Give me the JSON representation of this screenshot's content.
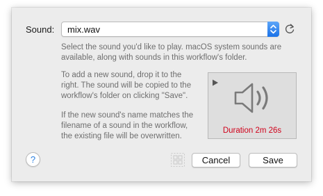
{
  "sound_field": {
    "label": "Sound:",
    "selected_value": "mix.wav"
  },
  "descriptions": {
    "select": "Select the sound you'd like to play. macOS system sounds are available, along with sounds in this workflow's folder.",
    "add": "To add a new sound, drop it to the right. The sound will be copied to the workflow's folder on clicking \"Save\".",
    "overwrite": "If the new sound's name matches the filename of a sound in the workflow, the existing file will be overwritten."
  },
  "preview": {
    "duration": "Duration 2m 26s",
    "duration_color": "#d0021b"
  },
  "buttons": {
    "help": "?",
    "cancel": "Cancel",
    "save": "Save"
  },
  "icons": {
    "refresh": "refresh-icon",
    "play": "play-icon",
    "speaker": "speaker-icon",
    "grid": "grid-icon",
    "chevron": "up-down-chevron-icon"
  },
  "colors": {
    "accent": "#1a72e8",
    "sheet_background": "#ececec"
  }
}
